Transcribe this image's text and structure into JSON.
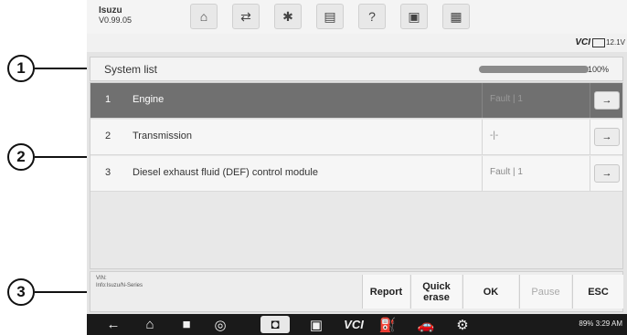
{
  "brand": {
    "name": "Isuzu",
    "version": "V0.99.05"
  },
  "toolbar": [
    {
      "icon": "home-icon",
      "glyph": "⌂"
    },
    {
      "icon": "vehicle-swap-icon",
      "glyph": "⇄"
    },
    {
      "icon": "settings-icon",
      "glyph": "✱"
    },
    {
      "icon": "print-icon",
      "glyph": "▤"
    },
    {
      "icon": "help-icon",
      "glyph": "?"
    },
    {
      "icon": "save-icon",
      "glyph": "▣"
    },
    {
      "icon": "message-icon",
      "glyph": "▦"
    }
  ],
  "status": {
    "vci": "VCI",
    "voltage": "12.1V"
  },
  "system_list": {
    "title": "System list",
    "progress_percent": 100,
    "progress_label": "100%"
  },
  "rows": [
    {
      "num": "1",
      "name": "Engine",
      "status": "Fault | 1",
      "selected": true
    },
    {
      "num": "2",
      "name": "Transmission",
      "status": "-|-",
      "selected": false
    },
    {
      "num": "3",
      "name": "Diesel exhaust fluid (DEF) control module",
      "status": "Fault | 1",
      "selected": false
    }
  ],
  "footer": {
    "vin_label": "VIN:",
    "info": "Info:Isuzu/N-Series",
    "buttons": {
      "report": "Report",
      "quick_erase": "Quick erase",
      "ok": "OK",
      "pause": "Pause",
      "esc": "ESC"
    }
  },
  "android": {
    "status": "89% 3:29 AM"
  },
  "callouts": [
    "1",
    "2",
    "3"
  ]
}
